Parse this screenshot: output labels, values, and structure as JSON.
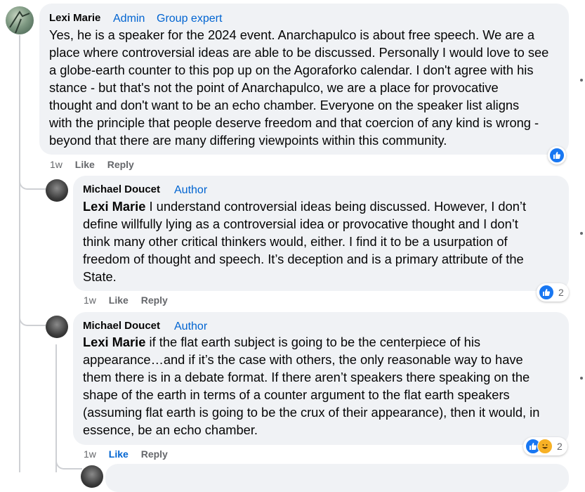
{
  "comments": [
    {
      "author": "Lexi Marie",
      "badges": [
        "Admin",
        "Group expert"
      ],
      "lines": [
        "Yes, he is a speaker for the 2024 event. Anarchapulco is about free speech. We are a",
        "place where controversial ideas are able to be discussed. Personally I would love to see",
        "a globe-earth counter to this pop up on the Agoraforko calendar. I don't agree with his",
        "stance - but that's not the point of Anarchapulco, we are a place for provocative",
        "thought and don't want to be an echo chamber. Everyone on the speaker list aligns",
        "with the principle that people deserve freedom and that coercion of any kind is wrong -",
        "beyond that there are many differing viewpoints within this community."
      ],
      "time": "1w",
      "like_label": "Like",
      "reply_label": "Reply",
      "reaction_icons": [
        "like-icon"
      ],
      "reaction_count": ""
    },
    {
      "author": "Michael Doucet",
      "badges": [
        "Author"
      ],
      "mention": "Lexi Marie",
      "lines": [
        " I understand controversial ideas being discussed. However, I don’t",
        "define willfully lying as a controversial idea or provocative thought and I don’t",
        "think many other critical thinkers would, either. I find it to be a usurpation of",
        "freedom of thought and speech. It’s deception and is a primary attribute of the",
        "State."
      ],
      "time": "1w",
      "like_label": "Like",
      "reply_label": "Reply",
      "reaction_icons": [
        "like-icon"
      ],
      "reaction_count": "2"
    },
    {
      "author": "Michael Doucet",
      "badges": [
        "Author"
      ],
      "mention": "Lexi Marie",
      "lines": [
        " if the flat earth subject is going to be the centerpiece of his",
        "appearance…and if it’s the case with others, the only reasonable way to have",
        "them there is in a debate format. If there aren’t speakers there speaking on the",
        "shape of the earth in terms of a counter argument to the flat earth speakers",
        "(assuming flat earth is going to be the crux of their appearance), then it would, in",
        "essence, be an echo chamber."
      ],
      "time": "1w",
      "like_label": "Like",
      "reply_label": "Reply",
      "reaction_icons": [
        "like-icon",
        "haha-icon"
      ],
      "reaction_count": "2"
    }
  ],
  "colors": {
    "bubble": "#f0f2f5",
    "link_blue": "#0064d1",
    "meta_gray": "#65676b",
    "like_blue": "#1877f2"
  }
}
